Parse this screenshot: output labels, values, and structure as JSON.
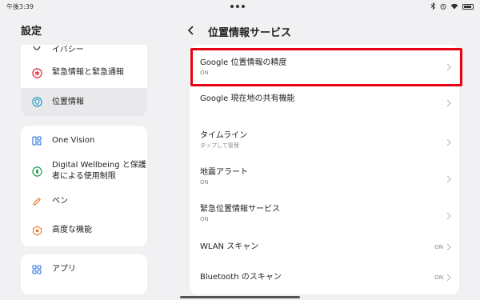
{
  "status": {
    "time": "午後3:39"
  },
  "left": {
    "title": "設定",
    "group1": [
      {
        "label": "イバシー"
      },
      {
        "label": "緊急情報と緊急通報"
      },
      {
        "label": "位置情報"
      }
    ],
    "group2": [
      {
        "label": "One Vision"
      },
      {
        "label": "Digital Wellbeing と保護者による使用制限"
      },
      {
        "label": "ペン"
      },
      {
        "label": "高度な機能"
      }
    ],
    "group3": [
      {
        "label": "アプリ"
      }
    ]
  },
  "right": {
    "title": "位置情報サービス",
    "items": [
      {
        "title": "Google 位置情報の精度",
        "subtitle": "ON"
      },
      {
        "title": "Google 現在地の共有機能"
      },
      {
        "title": "タイムライン",
        "subtitle": "タップして管理"
      },
      {
        "title": "地震アラート",
        "subtitle": "ON"
      },
      {
        "title": "緊急位置情報サービス",
        "subtitle": "ON"
      },
      {
        "title": "WLAN スキャン",
        "value": "ON"
      },
      {
        "title": "Bluetooth のスキャン",
        "value": "ON"
      }
    ]
  },
  "colors": {
    "highlight": "#e60012",
    "selected_bg": "#e9e9ec"
  },
  "icons": [
    "privacy-icon",
    "emergency-icon",
    "location-icon",
    "one-vision-icon",
    "wellbeing-icon",
    "pen-icon",
    "advanced-features-icon",
    "apps-icon",
    "back-arrow-icon",
    "chevron-right-icon"
  ]
}
